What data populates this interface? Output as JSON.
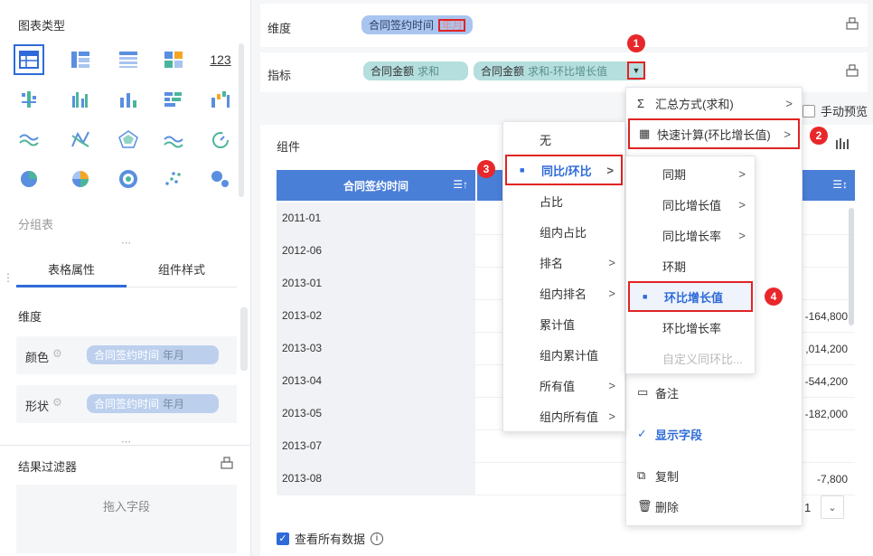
{
  "left": {
    "chart_types_title": "图表类型",
    "number_icon_text": "123",
    "group_table_label": "分组表",
    "tabs": [
      "表格属性",
      "组件样式"
    ],
    "dimension_label": "维度",
    "color_label": "颜色",
    "shape_label": "形状",
    "field_name": "合同签约时间",
    "field_unit": "年月",
    "result_filter_label": "结果过滤器",
    "drop_hint": "拖入字段"
  },
  "config": {
    "dimension_label": "维度",
    "dimension_field": "合同签约时间",
    "dimension_unit": "年月",
    "metric_label": "指标",
    "metric1_name": "合同金额",
    "metric1_agg": "求和",
    "metric2_name": "合同金额",
    "metric2_agg": "求和-环比增长值",
    "manual_preview": "手动预览"
  },
  "component": {
    "title": "组件",
    "column_header": "合同签约时间",
    "rows": [
      {
        "date": "2011-01",
        "value": ""
      },
      {
        "date": "2012-06",
        "value": ""
      },
      {
        "date": "2013-01",
        "value": ""
      },
      {
        "date": "2013-02",
        "value": "-164,800"
      },
      {
        "date": "2013-03",
        "value": ",014,200"
      },
      {
        "date": "2013-04",
        "value": "-544,200"
      },
      {
        "date": "2013-05",
        "value": "-182,000"
      },
      {
        "date": "2013-07",
        "value": ""
      },
      {
        "date": "2013-08",
        "value": "-7,800"
      }
    ],
    "page_number": "1",
    "view_all_data": "查看所有数据"
  },
  "menu_main": {
    "summary": "汇总方式(求和)",
    "quick_calc": "快速计算(环比增长值)",
    "remark": "备注",
    "show_field": "显示字段",
    "copy": "复制",
    "delete": "删除"
  },
  "menu_calc": {
    "items": [
      "无",
      "同比/环比",
      "占比",
      "组内占比",
      "排名",
      "组内排名",
      "累计值",
      "组内累计值",
      "所有值",
      "组内所有值"
    ]
  },
  "menu_yoy": {
    "items": [
      "同期",
      "同比增长值",
      "同比增长率",
      "环期",
      "环比增长值",
      "环比增长率",
      "自定义同环比..."
    ]
  },
  "badges": [
    "1",
    "2",
    "3",
    "4"
  ],
  "colors": {
    "accent": "#2f6bd8",
    "header_blue": "#4a7fd8",
    "highlight_red": "#e02424"
  }
}
